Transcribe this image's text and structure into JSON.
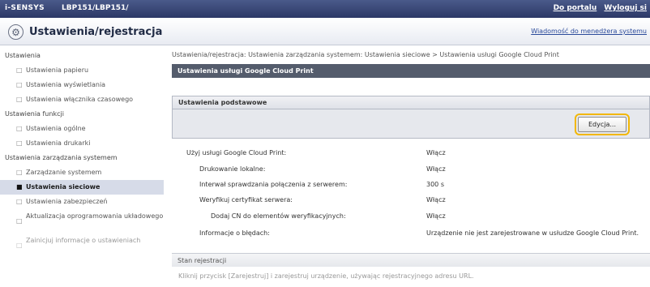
{
  "header": {
    "brand": "i-SENSYS",
    "model": "LBP151/LBP151/",
    "portal_link": "Do portalu",
    "logout_link": "Wyloguj si"
  },
  "title": {
    "icon": "gear-icon",
    "text": "Ustawienia/rejestracja",
    "message_link": "Wiadomość do menedżera systemu"
  },
  "sidebar": {
    "groups": [
      {
        "label": "Ustawienia",
        "items": [
          {
            "label": "Ustawienia papieru",
            "active": false
          },
          {
            "label": "Ustawienia wyświetlania",
            "active": false
          },
          {
            "label": "Ustawienia włącznika czasowego",
            "active": false
          }
        ]
      },
      {
        "label": "Ustawienia funkcji",
        "items": [
          {
            "label": "Ustawienia ogólne",
            "active": false
          },
          {
            "label": "Ustawienia drukarki",
            "active": false
          }
        ]
      },
      {
        "label": "Ustawienia zarządzania systemem",
        "items": [
          {
            "label": "Zarządzanie systemem",
            "active": false
          },
          {
            "label": "Ustawienia sieciowe",
            "active": true
          },
          {
            "label": "Ustawienia zabezpieczeń",
            "active": false
          },
          {
            "label": "Aktualizacja oprogramowania układowego",
            "active": false
          },
          {
            "label": "Zainicjuj informacje o ustawieniach",
            "active": false
          }
        ]
      }
    ]
  },
  "main": {
    "breadcrumb": "Ustawienia/rejestracja: Ustawienia zarządzania systemem: Ustawienia sieciowe > Ustawienia usługi Google Cloud Print",
    "section_title": "Ustawienia usługi Google Cloud Print",
    "basic_header": "Ustawienia podstawowe",
    "edit_button": "Edycja...",
    "settings": [
      {
        "label": "Użyj usługi Google Cloud Print:",
        "value": "Włącz"
      },
      {
        "label": "Drukowanie lokalne:",
        "value": "Włącz"
      },
      {
        "label": "Interwał sprawdzania połączenia z serwerem:",
        "value": "300 s"
      },
      {
        "label": "Weryfikuj certyfikat serwera:",
        "value": "Włącz"
      },
      {
        "label": "Dodaj CN do elementów weryfikacyjnych:",
        "value": "Włącz"
      },
      {
        "label": "Informacje o błędach:",
        "value": "Urządzenie nie jest zarejestrowane w usłudze Google Cloud Print."
      }
    ],
    "registration_header": "Stan rejestracji",
    "registration_text": "Kliknij przycisk [Zarejestruj] i zarejestruj urządzenie, używając rejestracyjnego adresu URL."
  }
}
